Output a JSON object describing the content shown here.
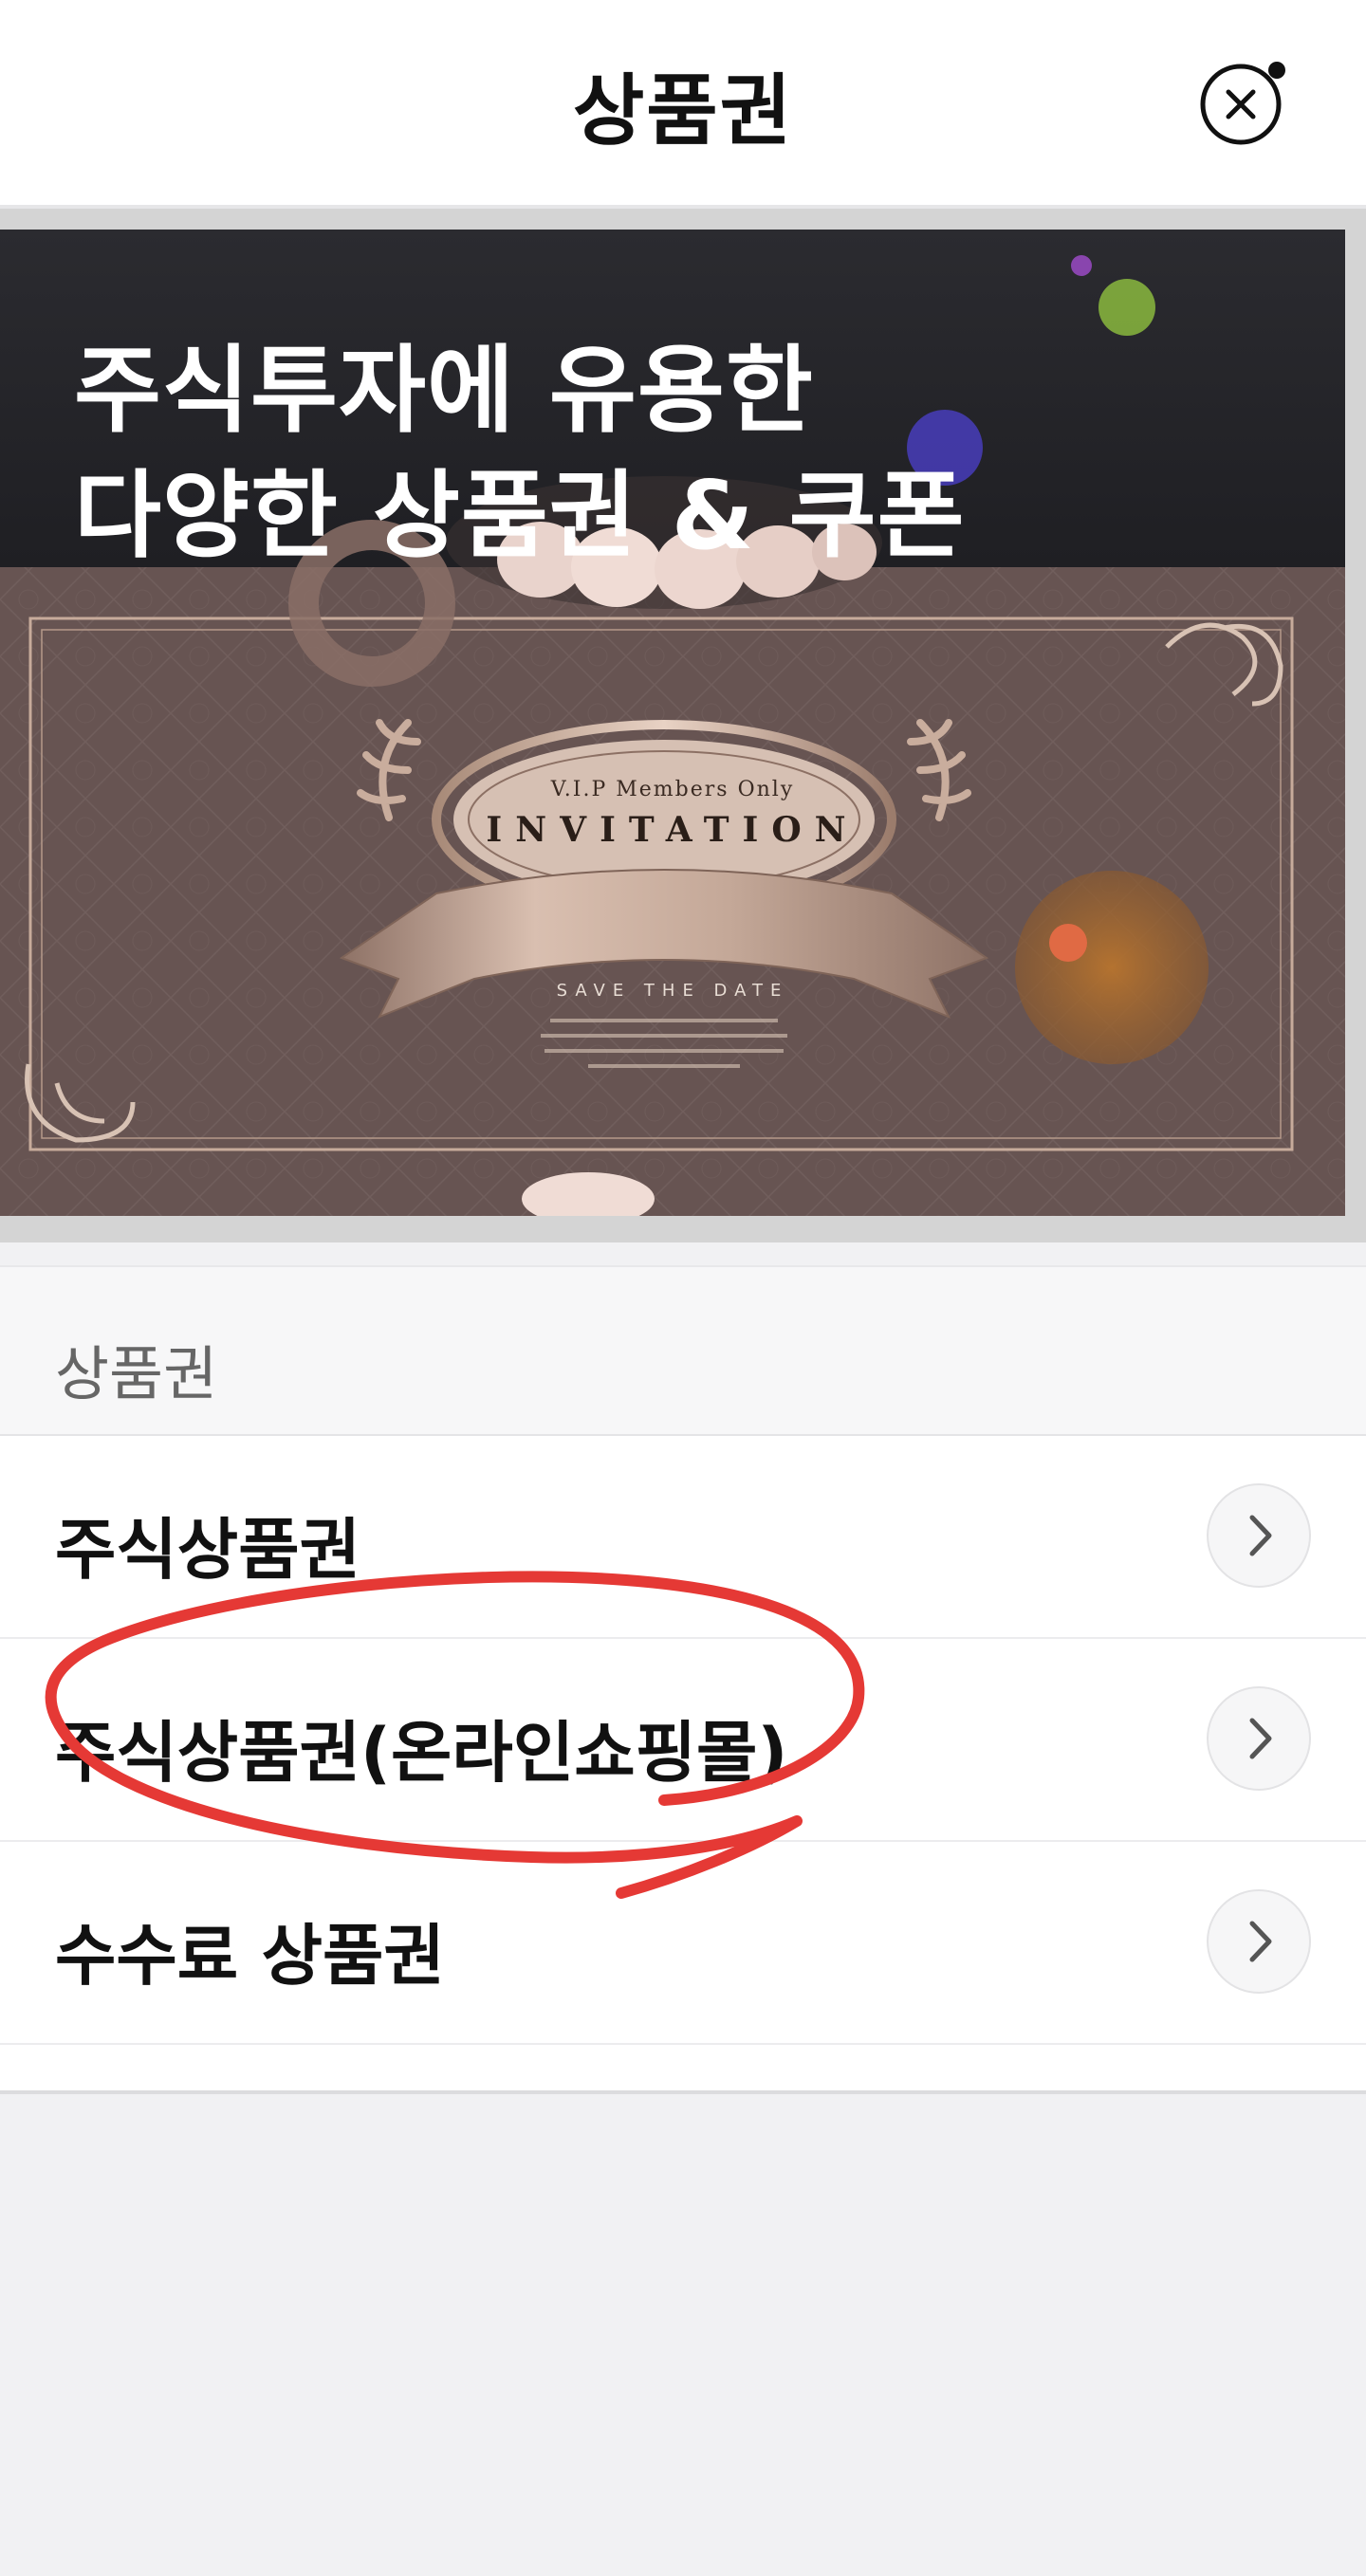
{
  "header": {
    "title": "상품권",
    "close_icon": "close-circle-icon"
  },
  "banner": {
    "headline_line1": "주식투자에 유용한",
    "headline_line2": "다양한 상품권 & 쿠폰",
    "card_top_text": "V.I.P Members Only",
    "card_main_text": "INVITATION",
    "card_date_text": "SAVE THE DATE"
  },
  "section": {
    "label": "상품권"
  },
  "rows": [
    {
      "label": "주식상품권",
      "icon": "chevron-right-icon"
    },
    {
      "label": "주식상품권(온라인쇼핑몰)",
      "icon": "chevron-right-icon"
    },
    {
      "label": "수수료 상품권",
      "icon": "chevron-right-icon"
    }
  ],
  "colors": {
    "annotation_red": "#e53935",
    "banner_dark": "#26262a",
    "card_brown": "#6e5c5a"
  }
}
